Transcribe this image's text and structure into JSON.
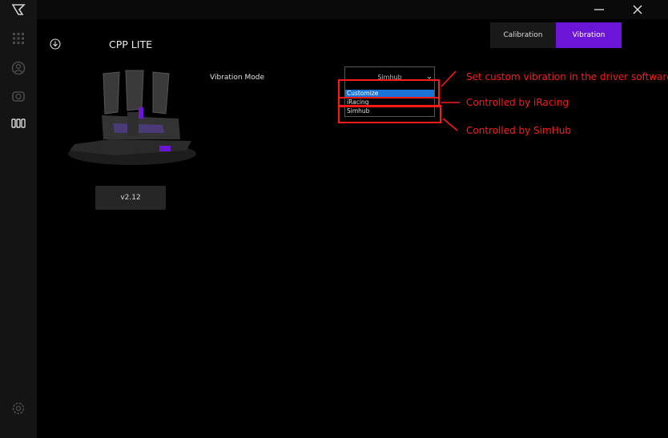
{
  "device": {
    "title": "CPP LITE",
    "version": "v2.12"
  },
  "tabs": [
    {
      "label": "Calibration"
    },
    {
      "label": "Vibration",
      "active": true
    }
  ],
  "vibration": {
    "label": "Vibration Mode",
    "selected_value": "Simhub",
    "options": [
      "Customize",
      "iRacing",
      "Simhub"
    ],
    "highlighted_option": "Customize"
  },
  "annotations": [
    "Set custom vibration in the driver software",
    "Controlled by iRacing",
    "Controlled by SimHub"
  ],
  "colors": {
    "accent": "#6b16d6",
    "annotation": "#ff1a1a",
    "selection": "#1a74d8"
  },
  "icons": {
    "sidebar": [
      "apps-grid-icon",
      "profile-icon",
      "camera-icon",
      "pedals-icon",
      "settings-gear-icon"
    ],
    "window": [
      "minimize-icon",
      "close-icon"
    ],
    "device": "download-icon",
    "logo": "brand-logo-icon"
  }
}
